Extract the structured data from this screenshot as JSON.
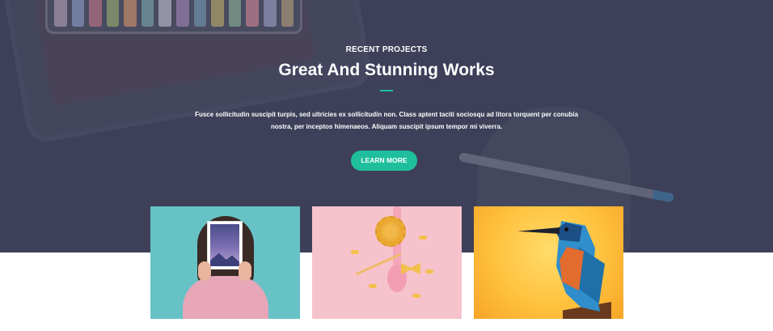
{
  "hero": {
    "eyebrow": "RECENT PROJECTS",
    "title": "Great And Stunning Works",
    "description": "Fusce sollicitudin suscipit turpis, sed ultricies ex sollicitudin non. Class aptent taciti sociosqu ad litora torquent per conubia nostra, per inceptos himenaeos. Aliquam suscipit ipsum tempor mi viverra.",
    "cta_label": "LEARN MORE"
  },
  "colors": {
    "hero_background": "#3d4058",
    "accent": "#1fbf9d",
    "card1_background": "#67c2c6",
    "card2_background": "#f6c3cc",
    "card3_background": "#ffc13d"
  },
  "projects": [
    {
      "image": "woman-holding-magazine"
    },
    {
      "image": "pasta-on-spoon"
    },
    {
      "image": "polygon-kingfisher"
    }
  ]
}
